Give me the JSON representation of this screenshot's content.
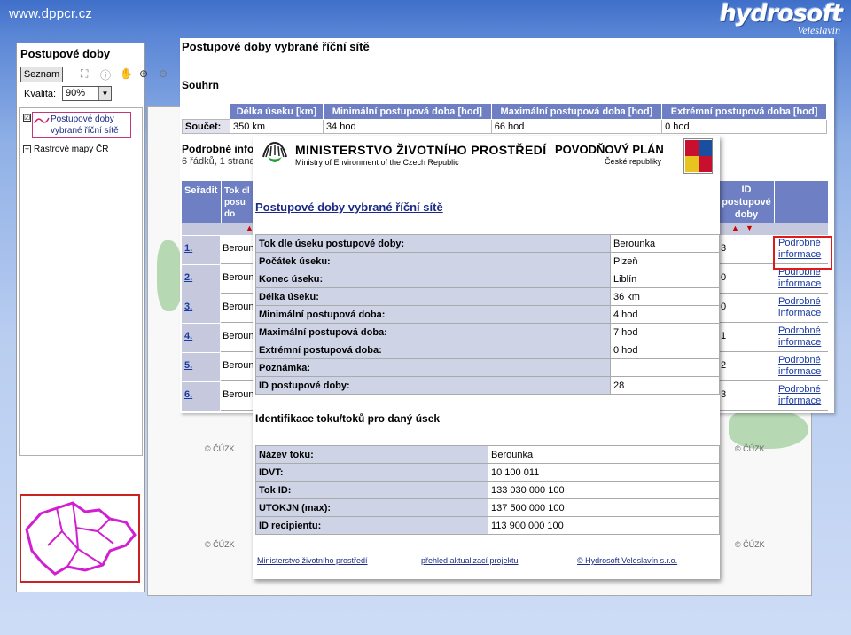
{
  "site": {
    "url": "www.dppcr.cz",
    "logo_name": "hydrosoft",
    "logo_place": "Veleslavín"
  },
  "gis": {
    "title": "Postupové doby",
    "seznam_button": "Seznam",
    "quality_label": "Kvalita:",
    "quality_value": "90%",
    "layers": [
      {
        "label": "Postupové doby vybrané říční sítě",
        "checked": true
      },
      {
        "label": "Rastrové mapy ČR",
        "checked": false
      }
    ],
    "checked_mark": "☑",
    "plus_mark": "+"
  },
  "back_window": {
    "title": "Postupové doby vybrané říční sítě",
    "summary_heading": "Souhrn",
    "summary_table": {
      "headers": [
        "Délka úseku [km]",
        "Minimální postupová doba [hod]",
        "Maximální postupová doba [hod]",
        "Extrémní postupová doba [hod]"
      ],
      "row_label": "Součet:",
      "values": [
        "350 km",
        "34 hod",
        "66 hod",
        "0 hod"
      ]
    },
    "detail_heading": "Podrobné info",
    "detail_sub": "6 řádků, 1 strana",
    "list_headers": {
      "sort": "Seřadit",
      "tok": "Tok dl posu do",
      "id": "ID postupové doby"
    },
    "rows": [
      {
        "num": "1.",
        "tok": "Beroun",
        "id": "3",
        "link1": "Podrobné",
        "link2": "informace"
      },
      {
        "num": "2.",
        "tok": "Beroun",
        "id": "0",
        "link1": "Podrobné",
        "link2": "informace"
      },
      {
        "num": "3.",
        "tok": "Beroun",
        "id": "0",
        "link1": "Podrobné",
        "link2": "informace"
      },
      {
        "num": "4.",
        "tok": "Beroun",
        "id": "1",
        "link1": "Podrobné",
        "link2": "informace"
      },
      {
        "num": "5.",
        "tok": "Beroun",
        "id": "2",
        "link1": "Podrobné",
        "link2": "informace"
      },
      {
        "num": "6.",
        "tok": "Beroun",
        "id": "3",
        "link1": "Podrobné",
        "link2": "informace"
      }
    ]
  },
  "map": {
    "copyright": "© ČÚZK"
  },
  "front_window": {
    "ministry_cz": "MINISTERSTVO ŽIVOTNÍHO PROSTŘEDÍ",
    "ministry_en": "Ministry of Environment of the Czech Republic",
    "plan_title": "POVODŇOVÝ PLÁN",
    "plan_sub": "České republiky",
    "title": "Postupové doby vybrané říční sítě",
    "detail_rows": [
      {
        "label": "Tok dle úseku postupové doby:",
        "value": "Berounka"
      },
      {
        "label": "Počátek úseku:",
        "value": "Plzeň"
      },
      {
        "label": "Konec úseku:",
        "value": "Liblín"
      },
      {
        "label": "Délka úseku:",
        "value": "36 km"
      },
      {
        "label": "Minimální postupová doba:",
        "value": "4 hod"
      },
      {
        "label": "Maximální postupová doba:",
        "value": "7 hod"
      },
      {
        "label": "Extrémní postupová doba:",
        "value": "0 hod"
      },
      {
        "label": "Poznámka:",
        "value": ""
      },
      {
        "label": "ID postupové doby:",
        "value": "28"
      }
    ],
    "ident_heading": "Identifikace toku/toků pro daný úsek",
    "ident_rows": [
      {
        "label": "Název toku:",
        "value": "Berounka"
      },
      {
        "label": "IDVT:",
        "value": "10 100 011"
      },
      {
        "label": "Tok ID:",
        "value": "133 030 000 100"
      },
      {
        "label": "UTOKJN (max):",
        "value": "137 500 000 100"
      },
      {
        "label": "ID recipientu:",
        "value": "113 900 000 100"
      }
    ],
    "footer_links": [
      "Ministerstvo životního prostředí",
      "přehled aktualizací projektu",
      "© Hydrosoft Veleslavín s.r.o."
    ]
  }
}
